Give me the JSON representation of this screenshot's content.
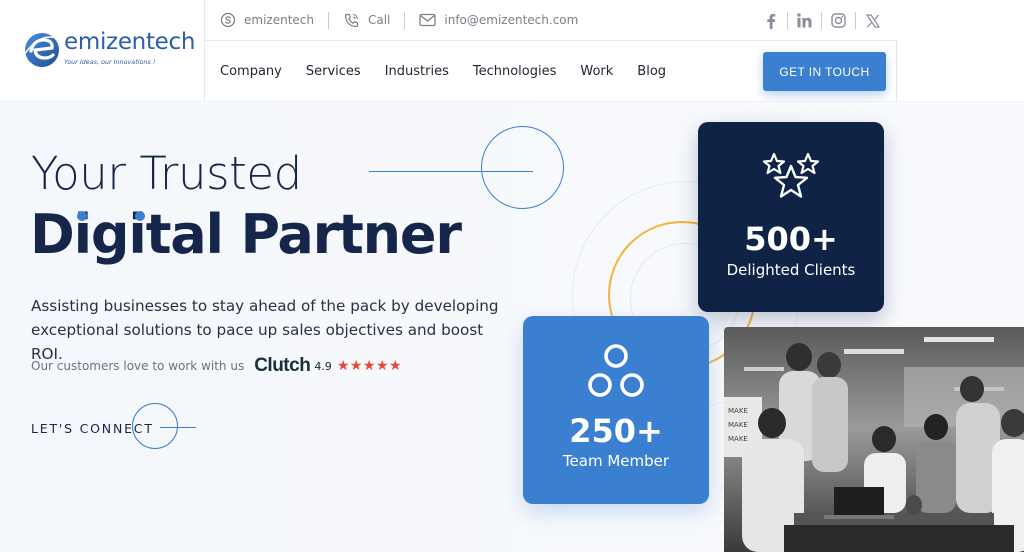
{
  "brand": {
    "name": "emizentech",
    "tagline": "Your Ideas, our Innovations !",
    "primary_color": "#3a7fd0",
    "dark_color": "#0f2346",
    "accent_color": "#f2b63c"
  },
  "topbar": {
    "skype": {
      "icon": "skype-icon",
      "label": "emizentech"
    },
    "call": {
      "icon": "phone-icon",
      "label": "Call"
    },
    "email": {
      "icon": "mail-icon",
      "label": "info@emizentech.com"
    },
    "socials": [
      "facebook-icon",
      "linkedin-icon",
      "instagram-icon",
      "x-icon"
    ]
  },
  "nav": {
    "items": [
      {
        "label": "Company"
      },
      {
        "label": "Services"
      },
      {
        "label": "Industries"
      },
      {
        "label": "Technologies"
      },
      {
        "label": "Work"
      },
      {
        "label": "Blog"
      }
    ],
    "cta": "GET IN TOUCH"
  },
  "hero": {
    "title_line1": "Your Trusted",
    "title_line2": "Digital Partner",
    "description": "Assisting businesses to stay ahead of the pack by developing exceptional solutions to pace up sales objectives and boost ROI.",
    "customers_text": "Our customers love to work with us",
    "clutch_brand": "Clutch",
    "clutch_rating": "4.9",
    "stars": "★★★★★",
    "connect_label": "LET'S CONNECT"
  },
  "stats": {
    "clients": {
      "icon": "stars-icon",
      "value": "500+",
      "label": "Delighted Clients"
    },
    "team": {
      "icon": "team-circles-icon",
      "value": "250+",
      "label": "Team Member"
    }
  }
}
